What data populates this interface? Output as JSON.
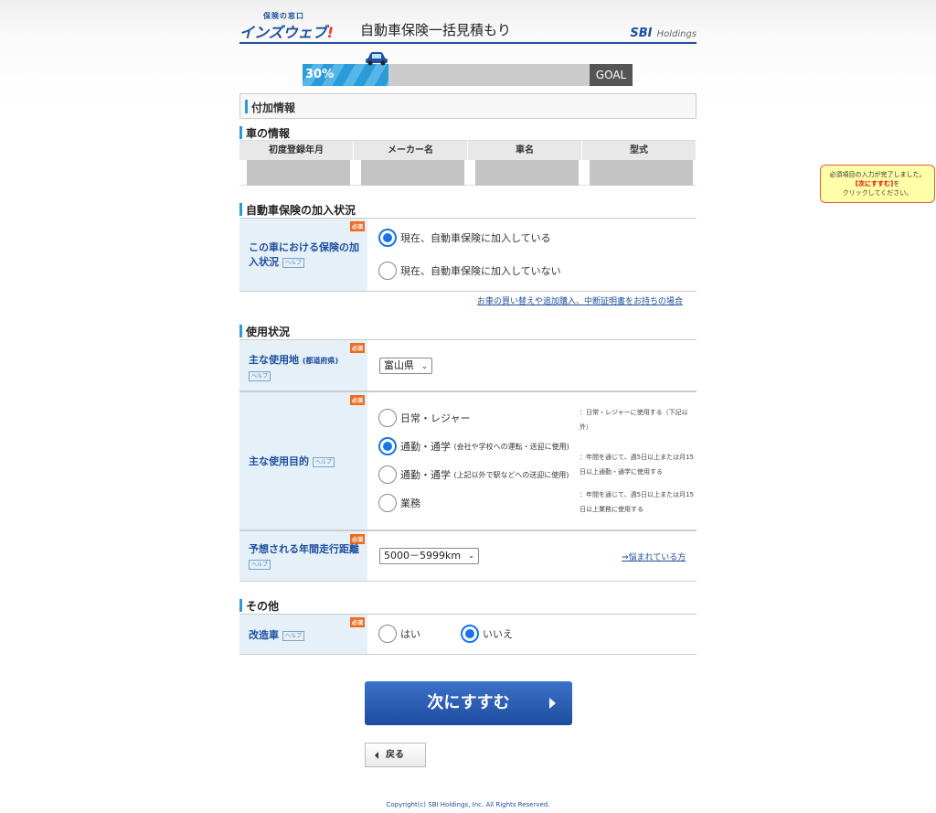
{
  "header": {
    "logo_small": "保険の窓口",
    "logo_main": "インズウェブ",
    "logo_bang": "!",
    "title": "自動車保険一括見積もり",
    "sbi_mark": "SBI",
    "sbi_holdings": "Holdings"
  },
  "progress": {
    "percent_label": "30%",
    "fraction": 0.3,
    "goal_label": "GOAL"
  },
  "section_title": "付加情報",
  "car_info": {
    "heading": "車の情報",
    "columns": [
      "初度登録年月",
      "メーカー名",
      "車名",
      "型式"
    ]
  },
  "insurance_status": {
    "heading": "自動車保険の加入状況",
    "label": "この車における保険の加入状況",
    "required": "必須",
    "help": "ヘルプ",
    "options": [
      "現在、自動車保険に加入している",
      "現在、自動車保険に加入していない"
    ],
    "selected_index": 0,
    "link": "お車の買い替えや追加購入、中断証明書をお持ちの場合"
  },
  "usage": {
    "heading": "使用状況",
    "location": {
      "label": "主な使用地",
      "label_small": "(都道府県)",
      "required": "必須",
      "help": "ヘルプ",
      "value": "富山県"
    },
    "purpose": {
      "label": "主な使用目的",
      "required": "必須",
      "help": "ヘルプ",
      "options": [
        {
          "label": "日常・レジャー",
          "sub": "",
          "note": "：日常・レジャーに使用する（下記以外）"
        },
        {
          "label": "通勤・通学",
          "sub": "(会社や学校への運転・送迎に使用)",
          "note": "：年間を通じて、週5日以上または月15日以上通勤・通学に使用する"
        },
        {
          "label": "通勤・通学",
          "sub": "(上記以外で駅などへの送迎に使用)",
          "note": ""
        },
        {
          "label": "業務",
          "sub": "",
          "note": "：年間を通じて、週5日以上または月15日以上業務に使用する"
        }
      ],
      "selected_index": 1
    },
    "distance": {
      "label": "予想される年間走行距離",
      "required": "必須",
      "help": "ヘルプ",
      "value": "5000－5999km",
      "link": "⇒悩まれている方"
    }
  },
  "other": {
    "heading": "その他",
    "modified": {
      "label": "改造車",
      "required": "必須",
      "help": "ヘルプ",
      "options": [
        "はい",
        "いいえ"
      ],
      "selected_index": 1
    }
  },
  "buttons": {
    "next": "次にすすむ",
    "back": "戻る"
  },
  "copyright": "Copyright(c) SBI Holdings, Inc. All Rights Reserved.",
  "tooltip": {
    "line1": "必須項目の入力が完了しました。",
    "line2": "[次にすすむ]",
    "line2_suffix": "を",
    "line3": "クリックしてください。"
  }
}
